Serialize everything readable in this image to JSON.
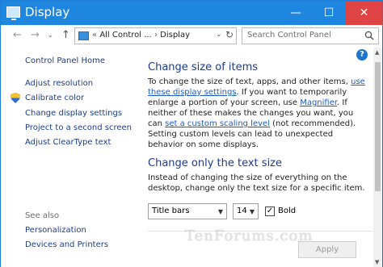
{
  "window": {
    "title": "Display",
    "minimize_glyph": "—",
    "maximize_glyph": "☐",
    "close_glyph": "✕"
  },
  "nav": {
    "back_glyph": "←",
    "forward_glyph": "→",
    "dropdown_glyph": "⌄",
    "up_glyph": "↑",
    "address_prefix": "«",
    "address_parent": "All Control ...",
    "address_sep": "›",
    "address_current": "Display",
    "address_caret": "⌄",
    "refresh_glyph": "↻",
    "search_placeholder": "Search Control Panel"
  },
  "sidebar": {
    "home": "Control Panel Home",
    "items": [
      "Adjust resolution",
      "Calibrate color",
      "Change display settings",
      "Project to a second screen",
      "Adjust ClearType text"
    ],
    "see_also": "See also",
    "see_also_items": [
      "Personalization",
      "Devices and Printers"
    ]
  },
  "content": {
    "help_glyph": "?",
    "section1_title": "Change size of items",
    "section1_p1": "To change the size of text, apps, and other items, ",
    "section1_link1": "use these display settings",
    "section1_p2": ".  If you want to temporarily enlarge a portion of your screen, use ",
    "section1_link2": "Magnifier",
    "section1_p3": ".  If neither of these makes the changes you want, you can ",
    "section1_link3": "set a custom scaling level",
    "section1_p4": " (not recommended).  Setting custom levels can lead to unexpected behavior on some displays.",
    "section2_title": "Change only the text size",
    "section2_p": "Instead of changing the size of everything on the desktop, change only the text size for a specific item.",
    "item_select_value": "Title bars",
    "size_select_value": "14",
    "bold_label": "Bold",
    "bold_checked_glyph": "✓",
    "apply_label": "Apply"
  },
  "watermark": "TenForums.com",
  "scroll": {
    "up_glyph": "▲",
    "down_glyph": "▼"
  },
  "colors": {
    "titlebar": "#1f86df",
    "close": "#e04343",
    "link": "#1a5bbf",
    "heading": "#1e3a8a"
  }
}
